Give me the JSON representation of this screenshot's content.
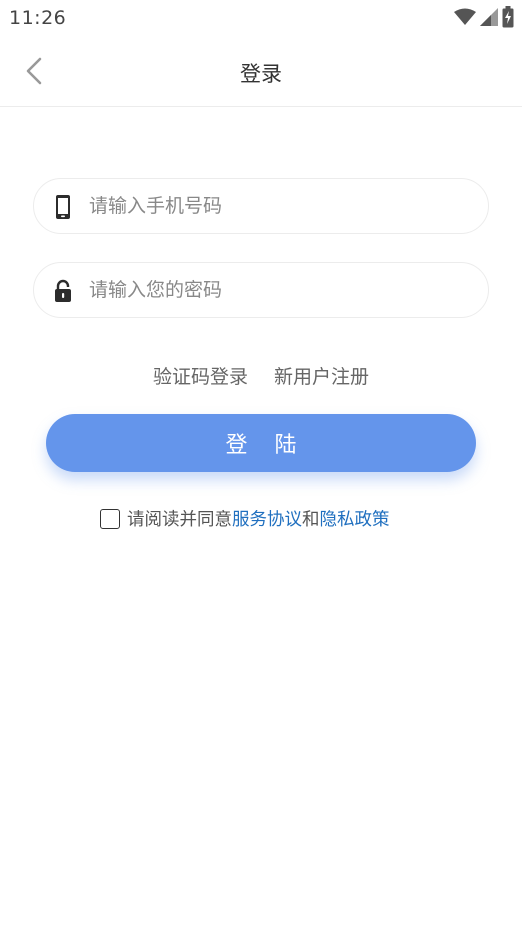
{
  "status_bar": {
    "time": "11:26",
    "icons": [
      "wifi-icon",
      "signal-icon",
      "battery-icon"
    ]
  },
  "header": {
    "back_icon": "back-arrow-icon",
    "title": "登录"
  },
  "form": {
    "phone": {
      "icon": "mobile-phone-icon",
      "placeholder": "请输入手机号码",
      "value": ""
    },
    "password": {
      "icon": "lock-icon",
      "placeholder": "请输入您的密码",
      "value": ""
    }
  },
  "links": {
    "code_login": "验证码登录",
    "register": "新用户注册"
  },
  "login_button": "登 陆",
  "agreement": {
    "checked": false,
    "prefix": "请阅读并同意",
    "service_link": "服务协议",
    "conjunction": "和",
    "privacy_link": "隐私政策"
  },
  "colors": {
    "accent": "#6495eb",
    "link": "#1f6fbf",
    "border": "#ececec"
  }
}
